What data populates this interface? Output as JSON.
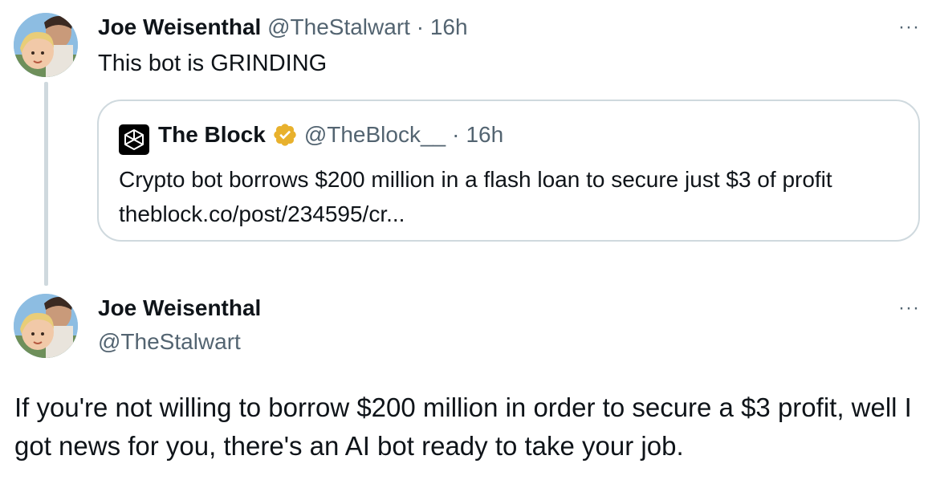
{
  "colors": {
    "text": "#0f1419",
    "secondary": "#536471",
    "border": "#cfd9de",
    "verified_gold": "#e8b12d"
  },
  "tweet1": {
    "name": "Joe Weisenthal",
    "handle": "@TheStalwart",
    "separator": "·",
    "time": "16h",
    "text": "This bot is GRINDING",
    "more_label": "···",
    "avatar_icon": "avatar-photo"
  },
  "quote": {
    "logo_icon": "the-block-logo-icon",
    "name": "The Block",
    "verified_icon": "verified-badge-icon",
    "handle": "@TheBlock__",
    "separator": "·",
    "time": "16h",
    "text": "Crypto bot borrows $200 million in a flash loan to secure just $3 of profit theblock.co/post/234595/cr..."
  },
  "tweet2": {
    "name": "Joe Weisenthal",
    "handle": "@TheStalwart",
    "more_label": "···",
    "text": "If you're not willing to borrow $200 million in order to secure a $3 profit, well I got news for you, there's an AI bot ready to take your job."
  }
}
